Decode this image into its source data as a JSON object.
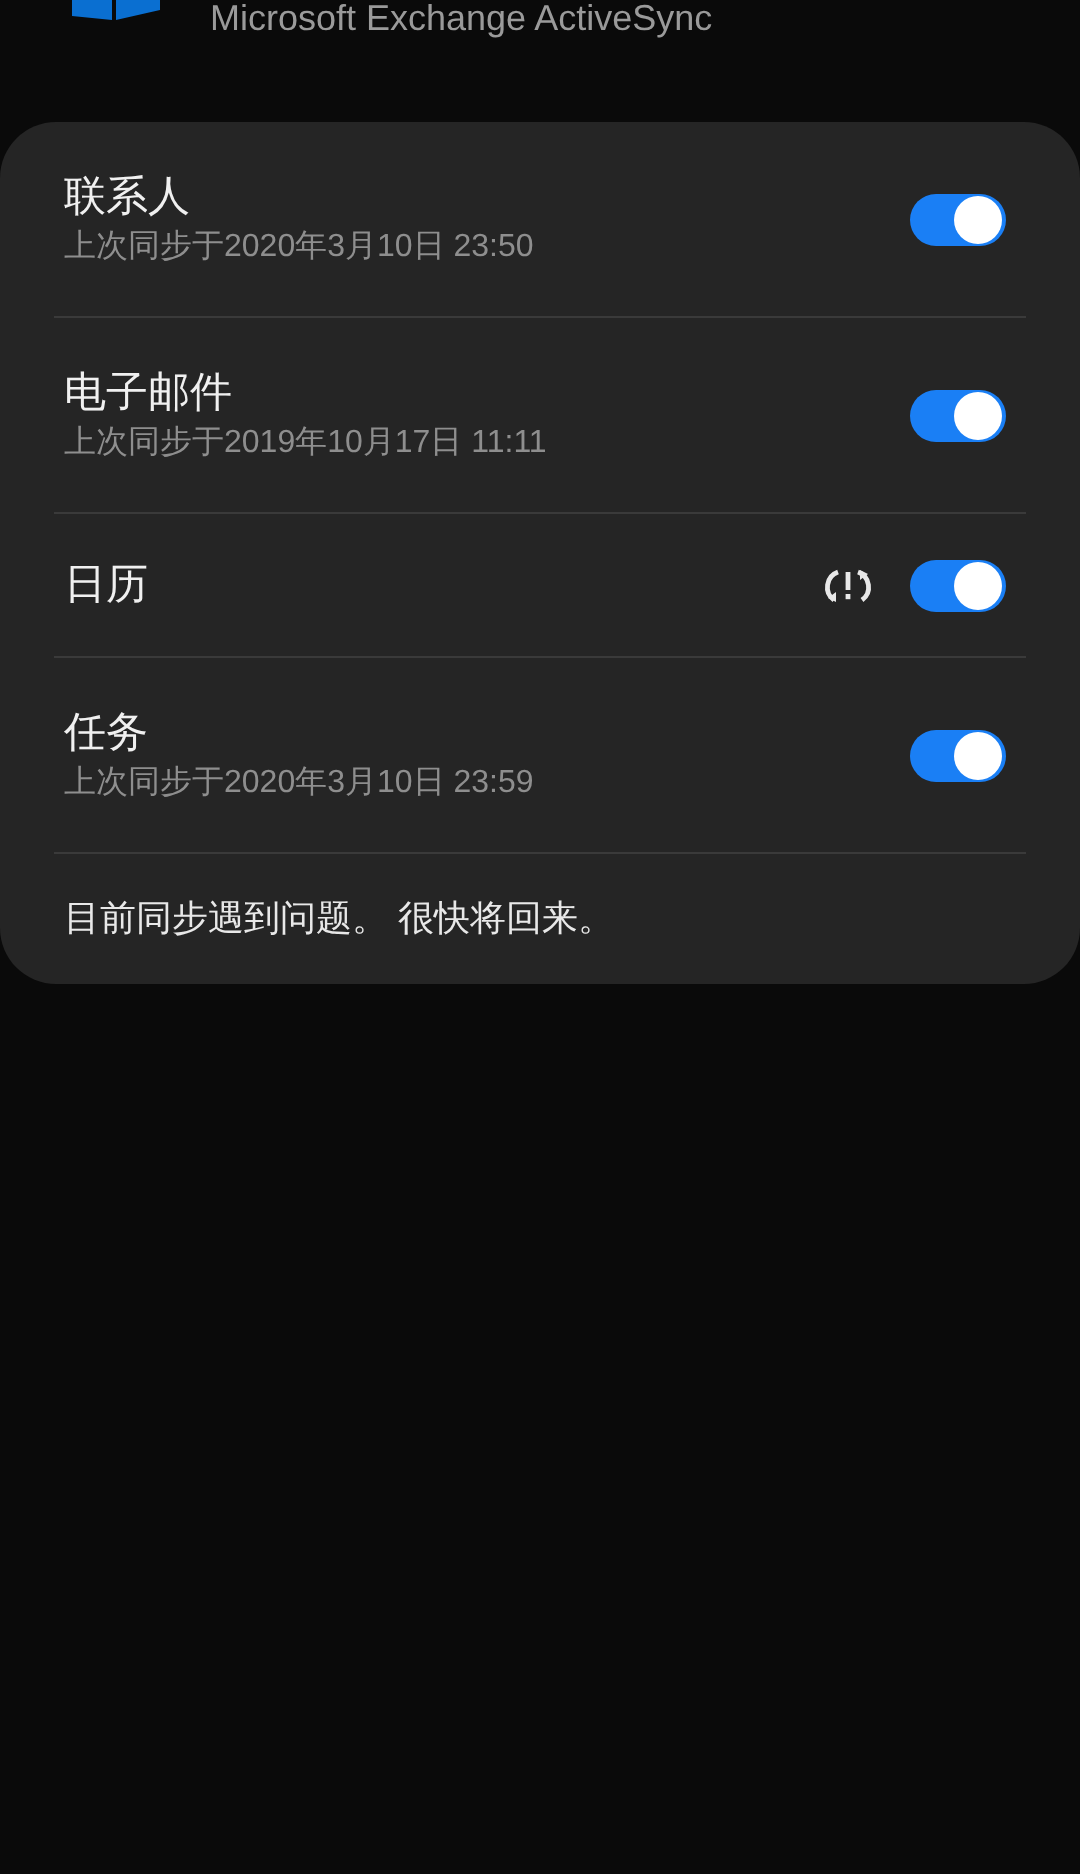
{
  "header": {
    "subtitle": "Microsoft Exchange ActiveSync"
  },
  "sync_items": [
    {
      "label": "联系人",
      "last_sync": "上次同步于2020年3月10日 23:50",
      "sync_error": false,
      "on": true
    },
    {
      "label": "电子邮件",
      "last_sync": "上次同步于2019年10月17日 11:11",
      "sync_error": false,
      "on": true
    },
    {
      "label": "日历",
      "sync_error": true,
      "on": true
    },
    {
      "label": "任务",
      "last_sync": "上次同步于2020年3月10日 23:59",
      "sync_error": false,
      "on": true
    }
  ],
  "status_message": "目前同步遇到问题。 很快将回来。"
}
